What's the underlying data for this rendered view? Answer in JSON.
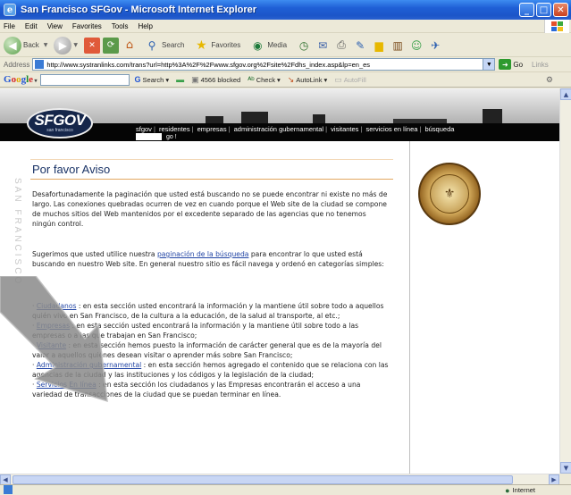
{
  "window": {
    "title": "San Francisco SFGov - Microsoft Internet Explorer",
    "icon": "ie-icon"
  },
  "menu": [
    "File",
    "Edit",
    "View",
    "Favorites",
    "Tools",
    "Help"
  ],
  "toolbar": {
    "back_label": "Back",
    "search_label": "Search",
    "favorites_label": "Favorites",
    "media_label": "Media"
  },
  "address": {
    "label": "Address",
    "url": "http://www.systranlinks.com/trans?url=http%3A%2F%2Fwww.sfgov.org%2Fsite%2Fdhs_index.asp&lp=en_es",
    "go_label": "Go",
    "links_label": "Links"
  },
  "google_toolbar": {
    "search_label": "Search",
    "blocked_label": "4566 blocked",
    "check_label": "Check",
    "autolink_label": "AutoLink",
    "autofill_label": "AutoFill"
  },
  "site": {
    "logo_big": "SFGOV",
    "logo_small": "san francisco",
    "nav": [
      "sfgov",
      "residentes",
      "empresas",
      "administración gubernamental",
      "visitantes",
      "servicios en línea",
      "búsqueda"
    ],
    "go_label": "go !",
    "side_text": "SAN FRANCISCO"
  },
  "content": {
    "heading": "Por favor Aviso",
    "p1": "Desafortunadamente la paginación que usted está buscando no se puede encontrar ni existe no más de largo. Las conexiones quebradas ocurren de vez en cuando porque el Web site de la ciudad se compone de muchos sitios del Web mantenidos por el excedente separado de las agencias que no tenemos ningún control.",
    "p2_before": "Sugerimos que usted utilice nuestra ",
    "p2_link": "paginación de la búsqueda",
    "p2_after": " para encontrar lo que usted está buscando en nuestro Web site. En general nuestro sitio es fácil navega y ordenó en categorías simples:",
    "items": [
      {
        "link": "Ciudadanos",
        "text": " : en esta sección usted encontrará la información y la mantiene útil sobre todo a aquellos quién vivo en San Francisco, de la cultura a la educación, de la salud al transporte, al etc.;"
      },
      {
        "link": "Empresas",
        "text": " : en esta sección usted encontrará la información y la mantiene útil sobre todo a las empresas o a las que trabajan en San Francisco;"
      },
      {
        "link": "Visitante",
        "text": " : en esta sección hemos puesto la información de carácter general que es de la mayoría del valor a aquellos quiénes desean visitar o aprender más sobre San Francisco;"
      },
      {
        "link": "Administración gubernamental",
        "text": " : en esta sección hemos agregado el contenido que se relaciona con las agencias de la ciudad y las instituciones y los códigos y la legislación de la ciudad;"
      },
      {
        "link": "Servicios En línea",
        "text": " : en esta sección los ciudadanos y las Empresas encontrarán el acceso a una variedad de transacciones de la ciudad que se puedan terminar en línea."
      }
    ]
  },
  "status": {
    "zone": "Internet"
  }
}
